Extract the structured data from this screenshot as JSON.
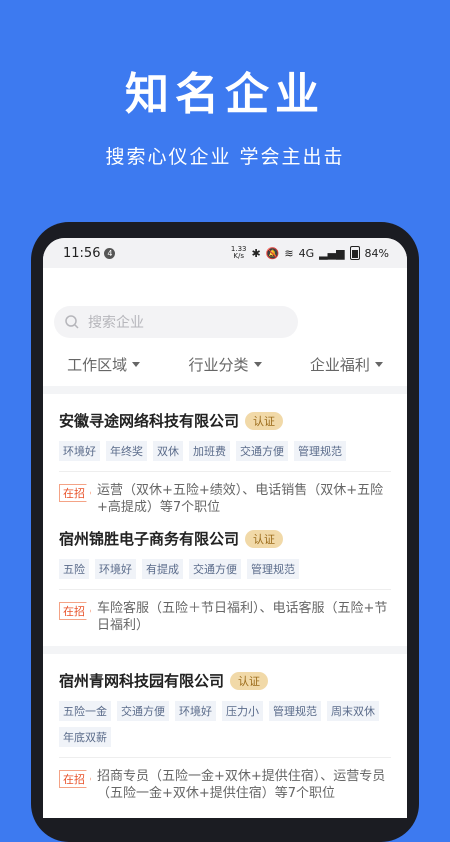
{
  "hero": {
    "title": "知名企业",
    "subtitle": "搜索心仪企业 学会主出击"
  },
  "status": {
    "time": "11:56",
    "notification_count": "4",
    "speed_top": "1.33",
    "speed_bottom": "K/s",
    "network": "4G",
    "battery": "84%"
  },
  "search": {
    "placeholder": "搜索企业"
  },
  "filters": [
    "工作区域",
    "行业分类",
    "企业福利"
  ],
  "companies": [
    {
      "name": "安徽寻途网络科技有限公司",
      "badge": "认证",
      "tags": [
        "环境好",
        "年终奖",
        "双休",
        "加班费",
        "交通方便",
        "管理规范"
      ],
      "hiring": "在招",
      "jobs": "运营（双休+五险+绩效）、电话销售（双休+五险+高提成）等7个职位"
    },
    {
      "name": "宿州锦胜电子商务有限公司",
      "badge": "认证",
      "tags": [
        "五险",
        "环境好",
        "有提成",
        "交通方便",
        "管理规范"
      ],
      "hiring": "在招",
      "jobs": "车险客服（五险＋节日福利）、电话客服（五险+节日福利）"
    },
    {
      "name": "宿州青网科技园有限公司",
      "badge": "认证",
      "tags": [
        "五险一金",
        "交通方便",
        "环境好",
        "压力小",
        "管理规范",
        "周末双休",
        "年底双薪"
      ],
      "hiring": "在招",
      "jobs": "招商专员（五险一金+双休+提供住宿）、运营专员（五险一金+双休+提供住宿）等7个职位"
    }
  ],
  "colors": {
    "background": "#3d7af0",
    "hiring": "#e8542c",
    "badge": "#f1d9a8"
  }
}
